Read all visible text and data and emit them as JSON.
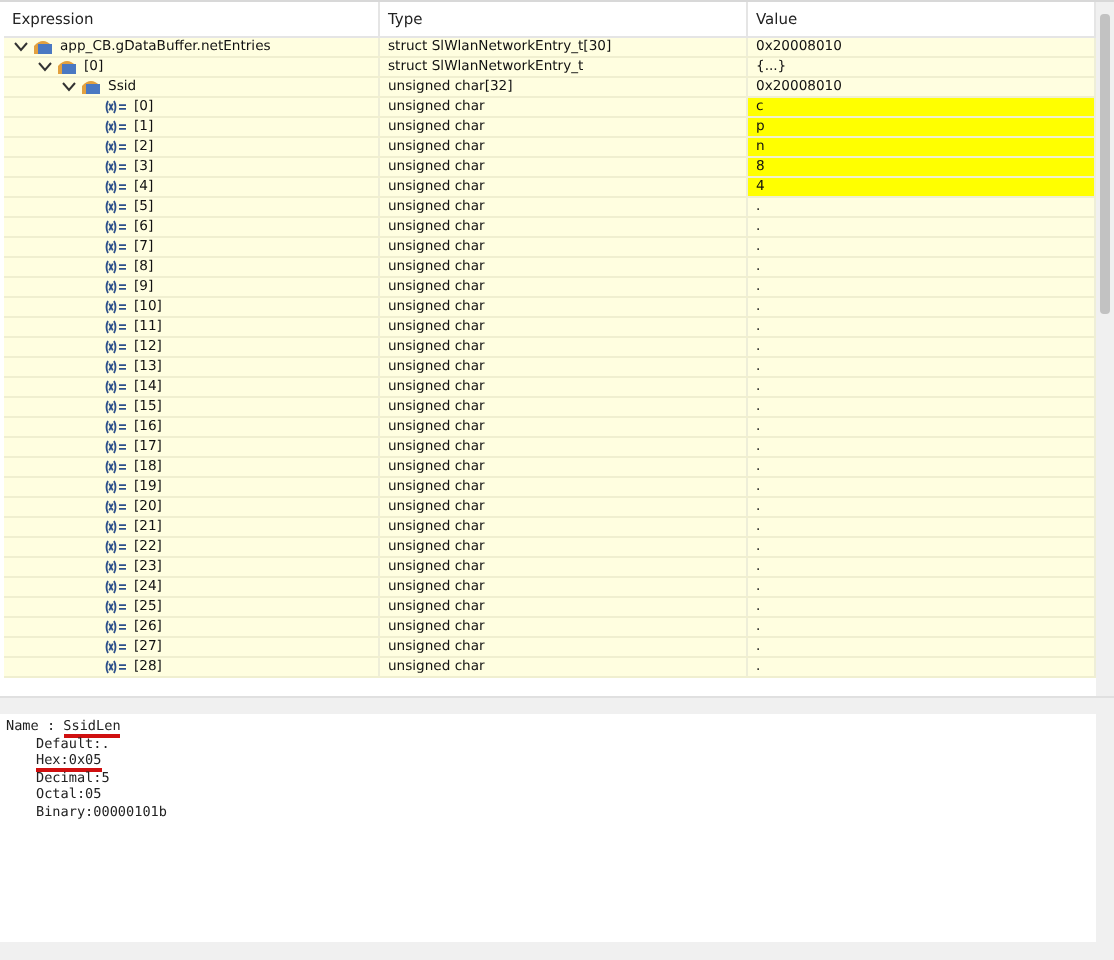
{
  "table": {
    "columns": [
      "Expression",
      "Type",
      "Value"
    ],
    "rows": [
      {
        "expression": "app_CB.gDataBuffer.netEntries",
        "type": "struct SlWlanNetworkEntry_t[30]",
        "value": "0x20008010",
        "kind": "struct",
        "changed": false,
        "expanded": true,
        "children": [
          {
            "expression": "[0]",
            "type": "struct SlWlanNetworkEntry_t",
            "value": "{...}",
            "kind": "struct",
            "changed": false,
            "expanded": true,
            "children": [
              {
                "expression": "Ssid",
                "type": "unsigned char[32]",
                "value": "0x20008010",
                "kind": "struct",
                "changed": false,
                "expanded": true,
                "children": [
                  {
                    "expression": "[0]",
                    "type": "unsigned char",
                    "value": "c",
                    "kind": "variable",
                    "changed": true
                  },
                  {
                    "expression": "[1]",
                    "type": "unsigned char",
                    "value": "p",
                    "kind": "variable",
                    "changed": true
                  },
                  {
                    "expression": "[2]",
                    "type": "unsigned char",
                    "value": "n",
                    "kind": "variable",
                    "changed": true
                  },
                  {
                    "expression": "[3]",
                    "type": "unsigned char",
                    "value": "8",
                    "kind": "variable",
                    "changed": true
                  },
                  {
                    "expression": "[4]",
                    "type": "unsigned char",
                    "value": "4",
                    "kind": "variable",
                    "changed": true
                  },
                  {
                    "expression": "[5]",
                    "type": "unsigned char",
                    "value": ".",
                    "kind": "variable",
                    "changed": false
                  },
                  {
                    "expression": "[6]",
                    "type": "unsigned char",
                    "value": ".",
                    "kind": "variable",
                    "changed": false
                  },
                  {
                    "expression": "[7]",
                    "type": "unsigned char",
                    "value": ".",
                    "kind": "variable",
                    "changed": false
                  },
                  {
                    "expression": "[8]",
                    "type": "unsigned char",
                    "value": ".",
                    "kind": "variable",
                    "changed": false
                  },
                  {
                    "expression": "[9]",
                    "type": "unsigned char",
                    "value": ".",
                    "kind": "variable",
                    "changed": false
                  },
                  {
                    "expression": "[10]",
                    "type": "unsigned char",
                    "value": ".",
                    "kind": "variable",
                    "changed": false
                  },
                  {
                    "expression": "[11]",
                    "type": "unsigned char",
                    "value": ".",
                    "kind": "variable",
                    "changed": false
                  },
                  {
                    "expression": "[12]",
                    "type": "unsigned char",
                    "value": ".",
                    "kind": "variable",
                    "changed": false
                  },
                  {
                    "expression": "[13]",
                    "type": "unsigned char",
                    "value": ".",
                    "kind": "variable",
                    "changed": false
                  },
                  {
                    "expression": "[14]",
                    "type": "unsigned char",
                    "value": ".",
                    "kind": "variable",
                    "changed": false
                  },
                  {
                    "expression": "[15]",
                    "type": "unsigned char",
                    "value": ".",
                    "kind": "variable",
                    "changed": false
                  },
                  {
                    "expression": "[16]",
                    "type": "unsigned char",
                    "value": ".",
                    "kind": "variable",
                    "changed": false
                  },
                  {
                    "expression": "[17]",
                    "type": "unsigned char",
                    "value": ".",
                    "kind": "variable",
                    "changed": false
                  },
                  {
                    "expression": "[18]",
                    "type": "unsigned char",
                    "value": ".",
                    "kind": "variable",
                    "changed": false
                  },
                  {
                    "expression": "[19]",
                    "type": "unsigned char",
                    "value": ".",
                    "kind": "variable",
                    "changed": false
                  },
                  {
                    "expression": "[20]",
                    "type": "unsigned char",
                    "value": ".",
                    "kind": "variable",
                    "changed": false
                  },
                  {
                    "expression": "[21]",
                    "type": "unsigned char",
                    "value": ".",
                    "kind": "variable",
                    "changed": false
                  },
                  {
                    "expression": "[22]",
                    "type": "unsigned char",
                    "value": ".",
                    "kind": "variable",
                    "changed": false
                  },
                  {
                    "expression": "[23]",
                    "type": "unsigned char",
                    "value": ".",
                    "kind": "variable",
                    "changed": false
                  },
                  {
                    "expression": "[24]",
                    "type": "unsigned char",
                    "value": ".",
                    "kind": "variable",
                    "changed": false
                  },
                  {
                    "expression": "[25]",
                    "type": "unsigned char",
                    "value": ".",
                    "kind": "variable",
                    "changed": false
                  },
                  {
                    "expression": "[26]",
                    "type": "unsigned char",
                    "value": ".",
                    "kind": "variable",
                    "changed": false
                  },
                  {
                    "expression": "[27]",
                    "type": "unsigned char",
                    "value": ".",
                    "kind": "variable",
                    "changed": false
                  },
                  {
                    "expression": "[28]",
                    "type": "unsigned char",
                    "value": ".",
                    "kind": "variable",
                    "changed": false
                  }
                ]
              }
            ]
          }
        ]
      }
    ]
  },
  "details": {
    "name_label": "Name : ",
    "name_value": "SsidLen",
    "name_annotated": true,
    "lines": [
      {
        "text": "Default:.",
        "annotated": false
      },
      {
        "text": "Hex:0x05",
        "annotated": true
      },
      {
        "text": "Decimal:5",
        "annotated": false
      },
      {
        "text": "Octal:05",
        "annotated": false
      },
      {
        "text": "Binary:00000101b",
        "annotated": false
      }
    ]
  }
}
